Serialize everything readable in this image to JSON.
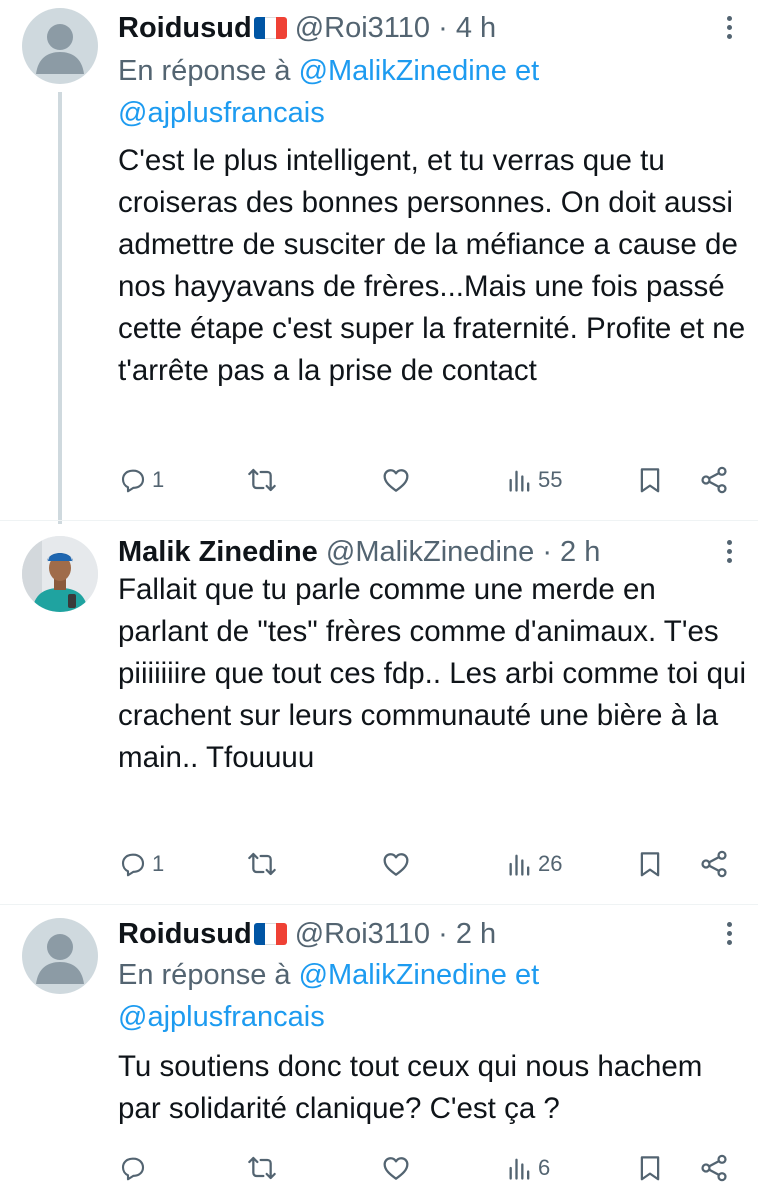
{
  "tweets": [
    {
      "name": "Roidusud",
      "flag": "France",
      "handle": "@Roi3110",
      "dot": "·",
      "time": "4 h",
      "reply_prefix": "En réponse à",
      "reply_user1": "@MalikZinedine",
      "reply_and": "et",
      "reply_user2": "@ajplusfrancais",
      "text": "C'est le plus intelligent, et tu verras que tu croiseras des bonnes personnes. On doit aussi admettre de susciter de la méfiance a cause de nos hayyavans de frères...Mais une fois passé cette étape c'est super la fraternité. Profite et ne t'arrête pas a la prise de contact",
      "replies": "1",
      "reposts": "",
      "likes": "",
      "views": "55"
    },
    {
      "name": "Malik Zinedine",
      "handle": "@MalikZinedine",
      "dot": "·",
      "time": "2 h",
      "text": "Fallait que tu parle comme une merde en parlant de \"tes\" frères comme d'animaux. T'es piiiiiiire que tout ces fdp.. Les arbi comme toi qui crachent sur leurs communauté une bière à la main.. Tfouuuu",
      "replies": "1",
      "reposts": "",
      "likes": "",
      "views": "26"
    },
    {
      "name": "Roidusud",
      "flag": "France",
      "handle": "@Roi3110",
      "dot": "·",
      "time": "2 h",
      "reply_prefix": "En réponse à",
      "reply_user1": "@MalikZinedine",
      "reply_and": "et",
      "reply_user2": "@ajplusfrancais",
      "text": "Tu soutiens donc tout ceux qui nous hachem par solidarité clanique? C'est ça ?",
      "replies": "",
      "reposts": "",
      "likes": "",
      "views": "6"
    }
  ],
  "colors": {
    "text": "#0f1419",
    "muted": "#536471",
    "link": "#1d9bf0",
    "avatar_default": "#cfd9de",
    "flag_blue": "#0055a4",
    "flag_white": "#ffffff",
    "flag_red": "#ef4135"
  },
  "icons": {
    "reply": "speech-bubble-icon",
    "repost": "repost-arrows-icon",
    "like": "heart-icon",
    "views": "bar-chart-icon",
    "bookmark": "bookmark-icon",
    "share": "share-icon",
    "more": "vertical-dots-icon"
  }
}
